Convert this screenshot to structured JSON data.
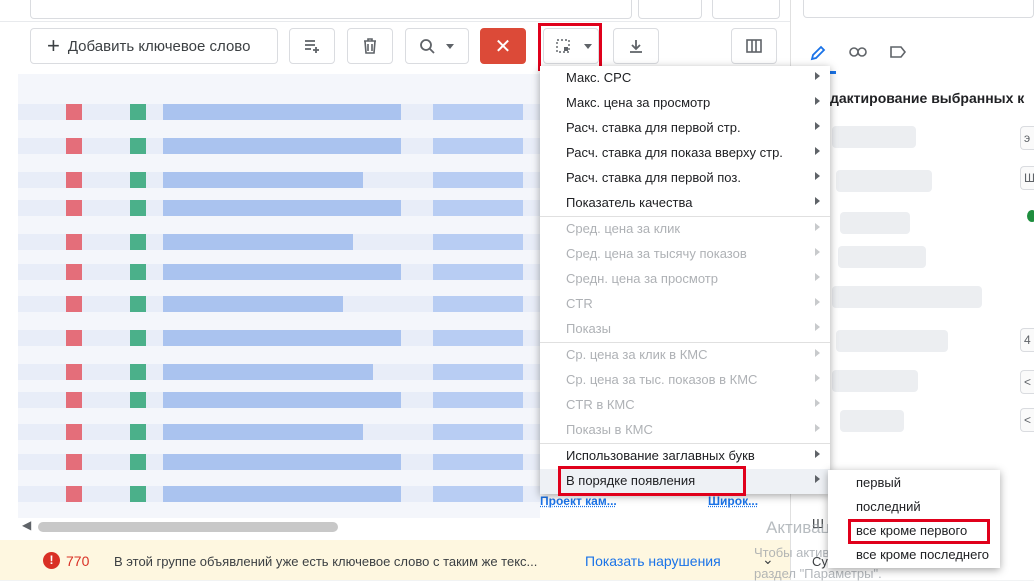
{
  "toolbar": {
    "add_keyword_label": "Добавить ключевое слово",
    "delete_icon": "close-icon"
  },
  "menu": {
    "items": [
      {
        "label": "Макс. CPC",
        "disabled": false
      },
      {
        "label": "Макс. цена за просмотр",
        "disabled": false
      },
      {
        "label": "Расч. ставка для первой стр.",
        "disabled": false
      },
      {
        "label": "Расч. ставка для показа вверху стр.",
        "disabled": false
      },
      {
        "label": "Расч. ставка для первой поз.",
        "disabled": false
      },
      {
        "label": "Показатель качества",
        "disabled": false
      },
      {
        "label": "Сред. цена за клик",
        "disabled": true
      },
      {
        "label": "Сред. цена за тысячу показов",
        "disabled": true
      },
      {
        "label": "Средн. цена за просмотр",
        "disabled": true
      },
      {
        "label": "CTR",
        "disabled": true
      },
      {
        "label": "Показы",
        "disabled": true
      },
      {
        "label": "Ср. цена за клик в КМС",
        "disabled": true
      },
      {
        "label": "Ср. цена за тыс. показов в КМС",
        "disabled": true
      },
      {
        "label": "CTR в КМС",
        "disabled": true
      },
      {
        "label": "Показы в КМС",
        "disabled": true
      },
      {
        "label": "Использование заглавных букв",
        "disabled": false
      },
      {
        "label": "В порядке появления",
        "disabled": false
      }
    ]
  },
  "submenu": {
    "items": [
      "первый",
      "последний",
      "все кроме первого",
      "все кроме последнего"
    ]
  },
  "grid_footer": {
    "left": "Проект кам...",
    "right": "Широк..."
  },
  "right_panel": {
    "heading": "дактирование выбранных к",
    "bottom_label": "Ш",
    "bottom_label2": "Су",
    "side_values": [
      "э",
      "Ш",
      "4",
      "<",
      "<"
    ]
  },
  "watermark": {
    "line1": "Активация Windows",
    "line2": "Чтобы активировать Windows, пере",
    "line3": "раздел \"Параметры\"."
  },
  "warning": {
    "count": "770",
    "text": "В этой группе объявлений уже есть ключевое слово с таким же текс...",
    "link": "Показать нарушения"
  },
  "colors": {
    "accent": "#1a73e8",
    "danger": "#dc4a38",
    "highlight_box": "#e0001b"
  }
}
